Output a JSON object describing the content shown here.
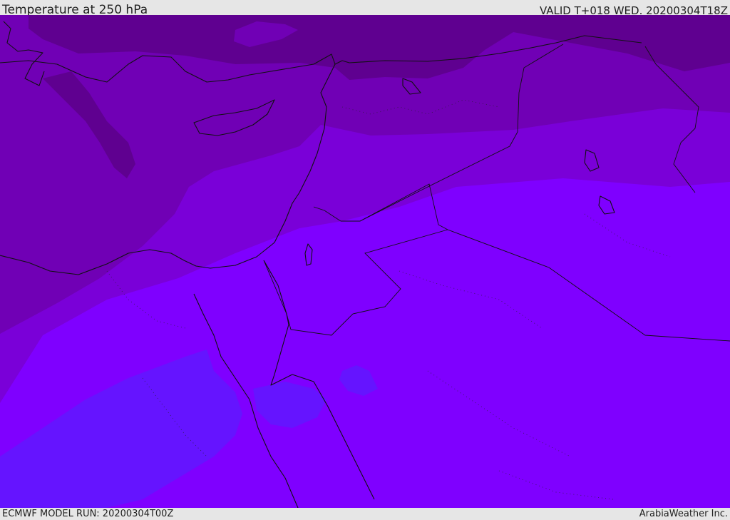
{
  "header": {
    "title": "Temperature at 250 hPa",
    "valid": "VALID T+018 WED. 20200304T18Z"
  },
  "footer": {
    "model_run": "ECMWF MODEL RUN: 20200304T00Z",
    "brand": "ArabiaWeather Inc."
  },
  "colors": {
    "band_coldest": "#5f0090",
    "band_cold": "#7000b5",
    "band_mid": "#7a00d8",
    "band_warm": "#7f00ff",
    "band_warmer": "#6514ff"
  }
}
